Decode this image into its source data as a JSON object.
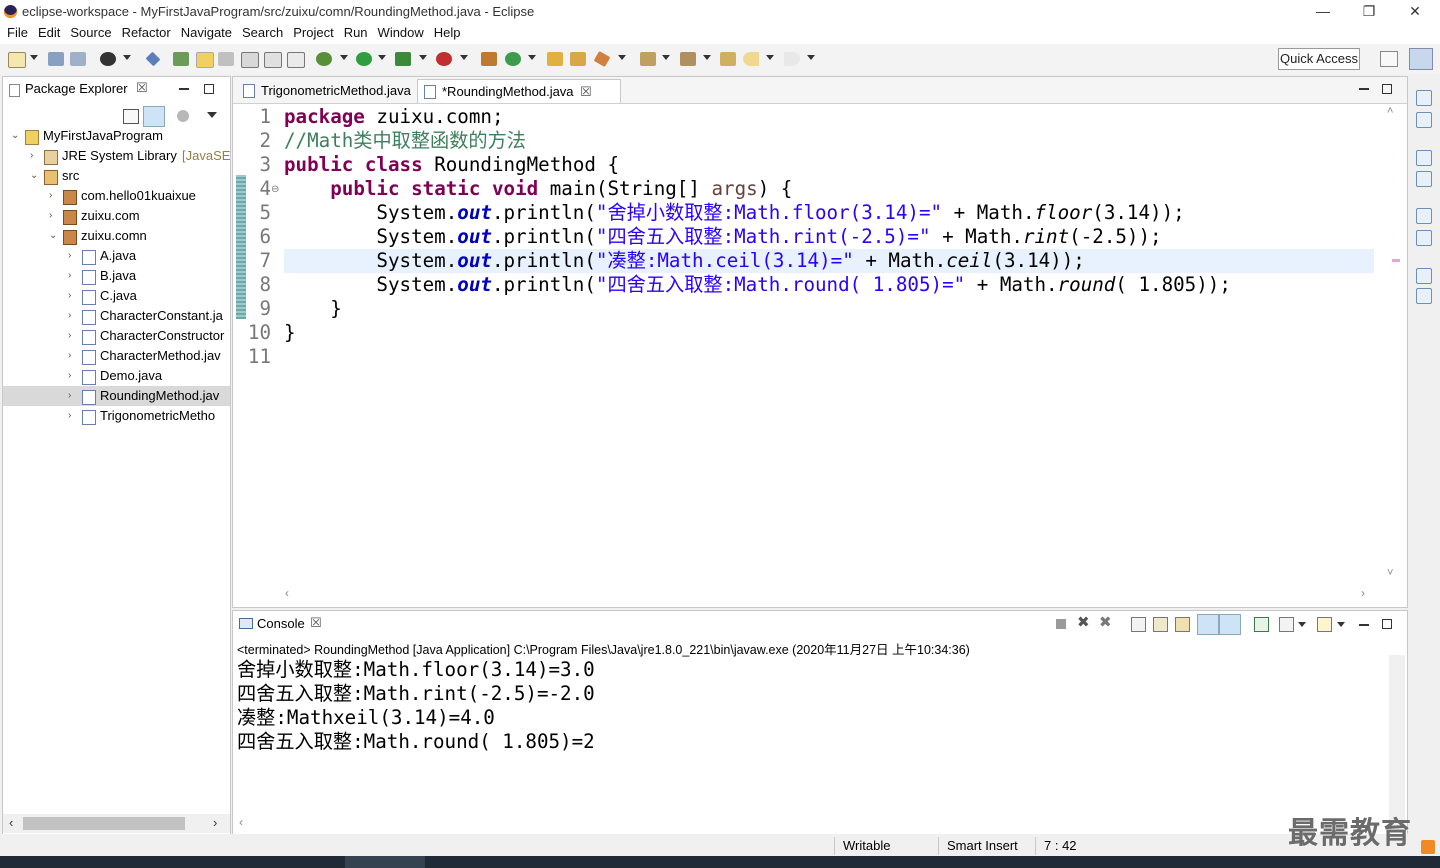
{
  "window": {
    "title": "eclipse-workspace - MyFirstJavaProgram/src/zuixu/comn/RoundingMethod.java - Eclipse",
    "minimize": "—",
    "restore": "❐",
    "close": "✕"
  },
  "menu": [
    "File",
    "Edit",
    "Source",
    "Refactor",
    "Navigate",
    "Search",
    "Project",
    "Run",
    "Window",
    "Help"
  ],
  "toolbar": {
    "quick_access": "Quick Access"
  },
  "package_explorer": {
    "title": "Package Explorer",
    "close": "☒",
    "tree": [
      {
        "label": "MyFirstJavaProgram",
        "level": 0,
        "twisty": "⌄",
        "icon": "project-icon"
      },
      {
        "label": "JRE System Library",
        "suffix": "[JavaSE-",
        "level": 1,
        "twisty": "›",
        "icon": "library-icon"
      },
      {
        "label": "src",
        "level": 1,
        "twisty": "⌄",
        "icon": "source-folder-icon"
      },
      {
        "label": "com.hello01kuaixue",
        "level": 2,
        "twisty": "›",
        "icon": "package-icon"
      },
      {
        "label": "zuixu.com",
        "level": 2,
        "twisty": "›",
        "icon": "package-icon"
      },
      {
        "label": "zuixu.comn",
        "level": 2,
        "twisty": "⌄",
        "icon": "package-icon"
      },
      {
        "label": "A.java",
        "level": 3,
        "twisty": "›",
        "icon": "java-file-icon"
      },
      {
        "label": "B.java",
        "level": 3,
        "twisty": "›",
        "icon": "java-file-icon"
      },
      {
        "label": "C.java",
        "level": 3,
        "twisty": "›",
        "icon": "java-file-icon"
      },
      {
        "label": "CharacterConstant.ja",
        "level": 3,
        "twisty": "›",
        "icon": "java-file-icon"
      },
      {
        "label": "CharacterConstructor",
        "level": 3,
        "twisty": "›",
        "icon": "java-file-icon"
      },
      {
        "label": "CharacterMethod.jav",
        "level": 3,
        "twisty": "›",
        "icon": "java-file-icon"
      },
      {
        "label": "Demo.java",
        "level": 3,
        "twisty": "›",
        "icon": "java-file-icon"
      },
      {
        "label": "RoundingMethod.jav",
        "level": 3,
        "twisty": "›",
        "icon": "java-file-icon",
        "selected": true
      },
      {
        "label": "TrigonometricMetho",
        "level": 3,
        "twisty": "›",
        "icon": "java-file-icon"
      }
    ]
  },
  "editor": {
    "tabs": [
      {
        "label": "TrigonometricMethod.java",
        "active": false
      },
      {
        "label": "*RoundingMethod.java",
        "active": true
      }
    ],
    "tab_close": "☒",
    "line_numbers": [
      "1",
      "2",
      "3",
      "4",
      "5",
      "6",
      "7",
      "8",
      "9",
      "10",
      "11"
    ],
    "code": {
      "l1_kw": "package",
      "l1_rest": " zuixu.comn;",
      "l2_comment": "//Math类中取整函数的方法",
      "l3_kw1": "public",
      "l3_kw2": "class",
      "l3_rest": " RoundingMethod {",
      "l4_indent": "    ",
      "l4_kw1": "public",
      "l4_kw2": "static",
      "l4_kw3": "void",
      "l4_rest": " main(String[] ",
      "l4_args": "args",
      "l4_end": ") {",
      "sys": "        System.",
      "out": "out",
      "println": ".println(",
      "l5_str": "\"舍掉小数取整:Math.floor(3.14)=\"",
      "l5_mid": " + Math.",
      "l5_method": "floor",
      "l5_end": "(3.14));",
      "l6_str": "\"四舍五入取整:Math.rint(-2.5)=\"",
      "l6_mid": " + Math.",
      "l6_method": "rint",
      "l6_end": "(-2.5));",
      "l7_str": "\"凑整:Math.ceil(3.14)=\"",
      "l7_mid": " + Math.",
      "l7_method": "ceil",
      "l7_end": "(3.14));",
      "l8_str": "\"四舍五入取整:Math.round( 1.805)=\"",
      "l8_mid": " + Math.",
      "l8_method": "round",
      "l8_end": "( 1.805));",
      "l9": "    }",
      "l10": "}"
    }
  },
  "console": {
    "title": "Console",
    "close": "☒",
    "status_line": "<terminated> RoundingMethod [Java Application] C:\\Program Files\\Java\\jre1.8.0_221\\bin\\javaw.exe (2020年11月27日 上午10:34:36)",
    "output": [
      "舍掉小数取整:Math.floor(3.14)=3.0",
      "四舍五入取整:Math.rint(-2.5)=-2.0",
      "凑整:Mathxeil(3.14)=4.0",
      "四舍五入取整:Math.round( 1.805)=2"
    ]
  },
  "statusbar": {
    "writable": "Writable",
    "insert_mode": "Smart Insert",
    "position": "7 : 42"
  },
  "watermark": "最需教育",
  "colors": {
    "keyword": "#7f0055",
    "comment": "#3f7f5f",
    "string": "#2a00ff",
    "field": "#0000c0",
    "current_line": "#e8f2fe",
    "selection": "#cce0f7"
  }
}
